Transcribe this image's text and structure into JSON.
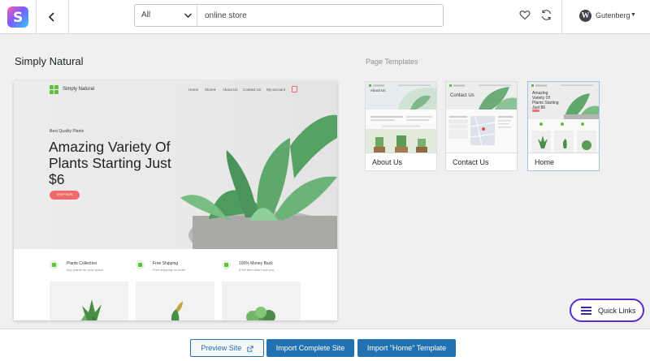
{
  "topbar": {
    "logo_letter": "S",
    "search": {
      "category": "All",
      "query": "online store"
    },
    "builder": {
      "label": "Gutenberg",
      "icon_letter": "W"
    }
  },
  "site": {
    "title": "Simply Natural"
  },
  "templates_heading": "Page Templates",
  "preview": {
    "brand": "Simply Natural",
    "menu": [
      "Home",
      "Store",
      "About Us",
      "Contact Us",
      "My account"
    ],
    "store_caret": "▾",
    "eyebrow": "Best Quality Plants",
    "headline": "Amazing Variety Of Plants Starting Just $6",
    "cta": "SHOP NOW",
    "features": [
      {
        "title": "Plants Collection",
        "subtitle": "Any plants for your space"
      },
      {
        "title": "Free Shipping",
        "subtitle": "Free shipping on order"
      },
      {
        "title": "100% Money Back",
        "subtitle": "If the item didn't suit you"
      }
    ],
    "accent": "#f26b6b",
    "brand_green": "#5dc13e"
  },
  "templates": [
    {
      "label": "About Us",
      "thumb_title": "About Us"
    },
    {
      "label": "Contact Us",
      "thumb_title": "Contact Us"
    },
    {
      "label": "Home",
      "thumb_title": "Amazing Variety Of Plants Starting Just $6"
    }
  ],
  "footer": {
    "preview_label": "Preview Site",
    "import_complete_label": "Import Complete Site",
    "import_template_label": "Import \"Home\" Template"
  },
  "quick_links": {
    "label": "Quick Links"
  },
  "colors": {
    "primary": "#2271b1",
    "quick_links_border": "#5b2bd3"
  }
}
